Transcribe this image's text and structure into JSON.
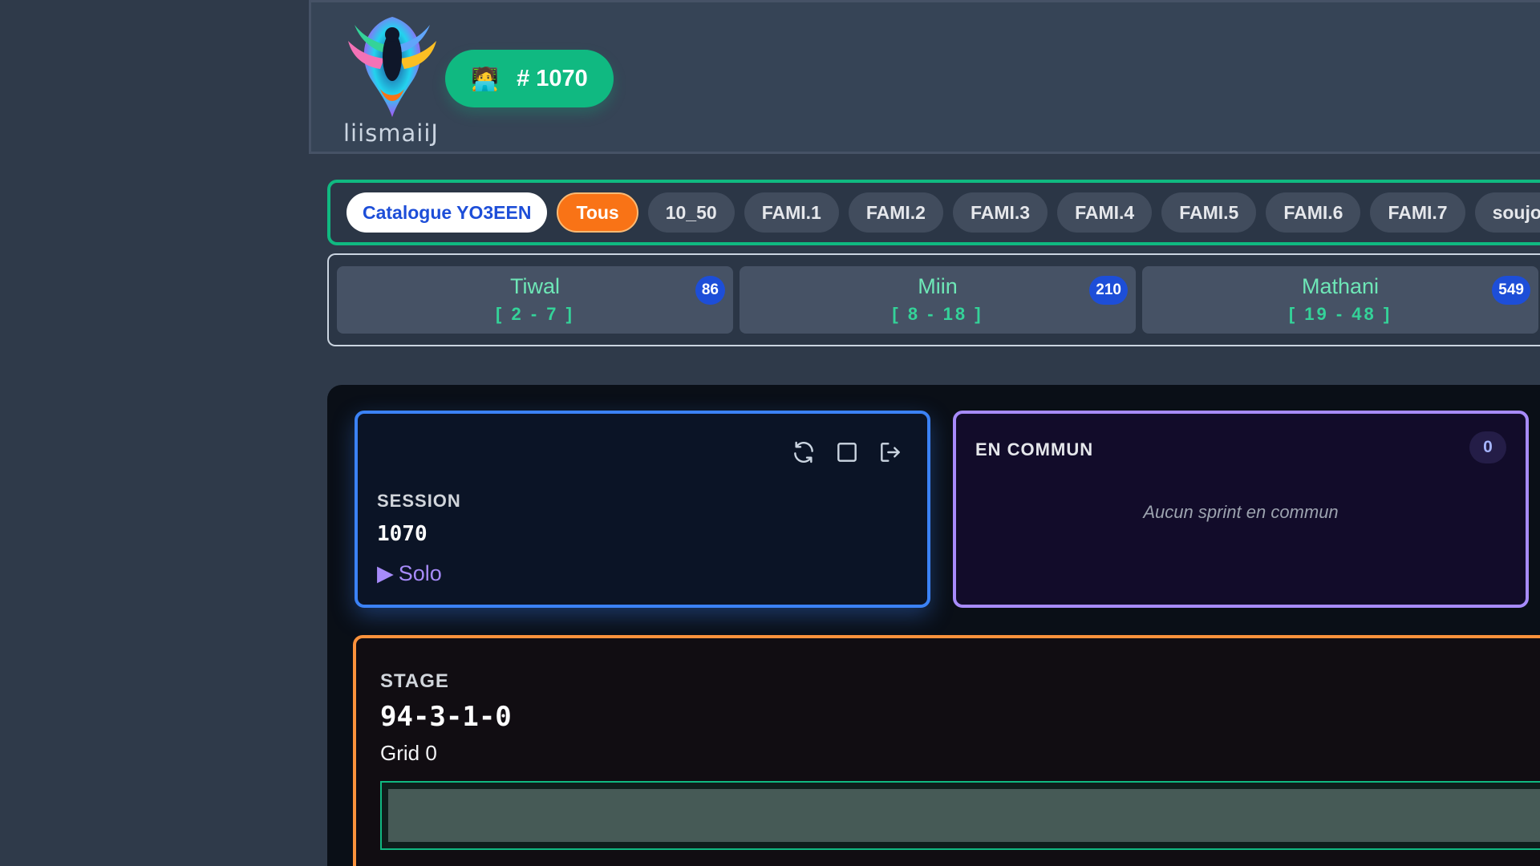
{
  "header": {
    "logo_text": "liismaiiJ",
    "session_pill": {
      "emoji": "🧑‍💻",
      "label": "# 1070"
    }
  },
  "categories": {
    "catalogue_label": "Catalogue YO3EEN",
    "chips": [
      "Tous",
      "10_50",
      "FAMI.1",
      "FAMI.2",
      "FAMI.3",
      "FAMI.4",
      "FAMI.5",
      "FAMI.6",
      "FAMI.7",
      "soujo"
    ],
    "active": "Tous"
  },
  "ranges": [
    {
      "name": "Tiwal",
      "span": "[ 2 - 7 ]",
      "count": "86"
    },
    {
      "name": "Miin",
      "span": "[ 8 - 18 ]",
      "count": "210"
    },
    {
      "name": "Mathani",
      "span": "[ 19 - 48 ]",
      "count": "549"
    }
  ],
  "session": {
    "label": "SESSION",
    "value": "1070",
    "mode": "Solo",
    "mode_icon": "▶",
    "icons": [
      "refresh-icon",
      "stop-icon",
      "logout-icon"
    ]
  },
  "common": {
    "title": "EN COMMUN",
    "count": "0",
    "empty_text": "Aucun sprint en commun"
  },
  "stage": {
    "label": "STAGE",
    "value": "94-3-1-0",
    "grid": "Grid 0"
  },
  "colors": {
    "accent_green": "#10b981",
    "accent_orange": "#f97316",
    "accent_blue": "#3b82f6",
    "accent_purple": "#a78bfa"
  }
}
